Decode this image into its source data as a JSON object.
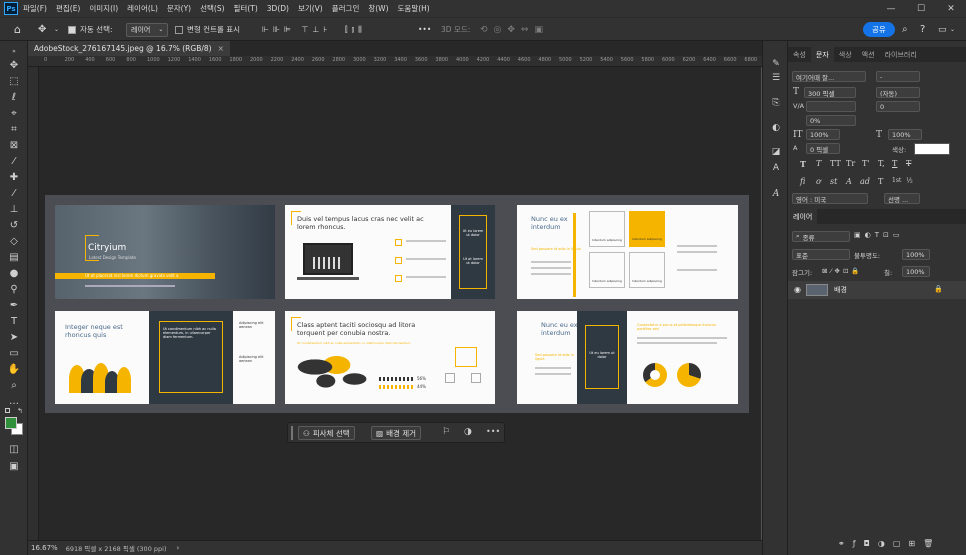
{
  "app": {
    "logo": "Ps"
  },
  "menu": [
    "파일(F)",
    "편집(E)",
    "이미지(I)",
    "레이어(L)",
    "문자(Y)",
    "선택(S)",
    "필터(T)",
    "3D(D)",
    "보기(V)",
    "플러그인",
    "창(W)",
    "도움말(H)"
  ],
  "window_controls": {
    "minimize": "—",
    "maximize": "☐",
    "close": "✕"
  },
  "options": {
    "auto_select_label": "자동 선택:",
    "auto_select_value": "레이어",
    "transform_label": "변형 컨트롤 표시",
    "mode_3d_label": "3D 모드:",
    "share_label": "공유",
    "more": "•••"
  },
  "document": {
    "tab_title": "AdobeStock_276167145.jpeg @ 16.7% (RGB/8)",
    "close": "×",
    "ruler_ticks": [
      "0",
      "200",
      "400",
      "600",
      "800",
      "1000",
      "1200",
      "1400",
      "1600",
      "1800",
      "2000",
      "2200",
      "2400",
      "2600",
      "2800",
      "3000",
      "3200",
      "3400",
      "3600",
      "3800",
      "4000",
      "4200",
      "4400",
      "4600",
      "4800",
      "5000",
      "5200",
      "5400",
      "5600",
      "5800",
      "6000",
      "6200",
      "6400",
      "6600",
      "6800",
      "7000"
    ]
  },
  "slides": {
    "s1_title": "Citryium",
    "s1_sub": "Latest Design Template",
    "s1_band": "Ut et placerat nisl lorem dictum gravida velit a",
    "s2_title": "Duis vel tempus lacus cras nec velit ac lorem rhoncus.",
    "s2_dark1": "Ut eu lorem ut dolor",
    "s2_dark2": "Ut at lorem ut dolor",
    "s3_title": "Nunc eu ex interdum",
    "s3_sub": "Sed posuere id odio in ligula",
    "s3_box1": "Interdum adipiscing",
    "s3_box2": "Interdum adipiscing",
    "s3_box3": "Interdum adipiscing",
    "s3_box4": "Interdum adipiscing",
    "s4_title": "Integer neque est rhoncus quis",
    "s4_dark": "Ut condimentum nibh ac nulla elementum, in ullamcorper diam fermentum.",
    "s4_item1": "Adipiscing elit aenean",
    "s4_item2": "Adipiscing elit aenean",
    "s5_title": "Class aptent taciti sociosqu ad litora torquent per conubia nostra.",
    "s5_band": "Ut condimentum nibh ac nulla elementum, in ullamcorper diam fermentum.",
    "s5_pct1": "56%",
    "s5_pct2": "44%",
    "s6_title": "Nunc eu ex interdum",
    "s6_sub": "Sed posuere id odio in ligula",
    "s6_dark": "Ut eu lorem ut dolor",
    "s6_band": "Consectetur a purus at pellentesque rhoncus porttitor sed"
  },
  "context_bar": {
    "select_subject": "피사체 선택",
    "remove_bg": "배경 제거",
    "more": "•••"
  },
  "status": {
    "zoom": "16.67%",
    "dims": "6918 픽셀 x 2168 픽셀 (300 ppi)",
    "arrow": "›"
  },
  "panels": {
    "tabs": [
      "속성",
      "문자",
      "색상",
      "액션",
      "라이브러리"
    ],
    "active_tab": "문자",
    "font_family": "여기어때 잘...",
    "font_style": "-",
    "font_size": "300 픽셀",
    "leading": "(자동)",
    "kerning": "V/A",
    "tracking_value": "0",
    "scale_pct": "0%",
    "vscale": "100%",
    "hscale": "100%",
    "baseline": "0 픽셀",
    "color_label": "색상:",
    "type_glyphs": [
      "T",
      "T",
      "TT",
      "Tr",
      "T'",
      "T,",
      "T",
      "T"
    ],
    "ot_glyphs": [
      "fi",
      "ơ",
      "st",
      "A",
      "ad",
      "T",
      "1st",
      "½"
    ],
    "language": "영어 : 미국",
    "aa": "선명 ...",
    "layers_tab": "레이어",
    "layer_filter": "종류",
    "blend_mode": "표준",
    "opacity_label": "불투명도:",
    "opacity": "100%",
    "lock_label": "잠그기:",
    "fill_label": "칠:",
    "fill": "100%",
    "layer_name": "배경"
  },
  "colors": {
    "accent": "#f5b400",
    "share": "#1473e6",
    "fg": "#2f8f3a",
    "bg": "#ffffff"
  }
}
